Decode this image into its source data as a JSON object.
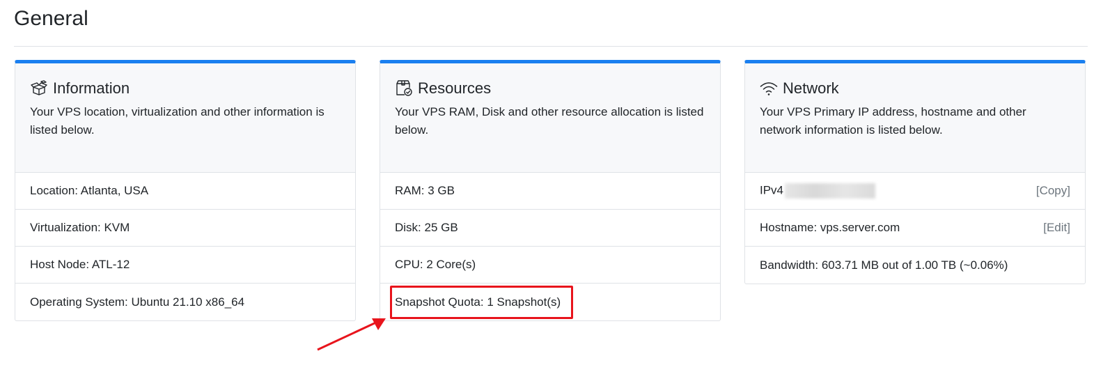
{
  "page": {
    "title": "General"
  },
  "cards": {
    "information": {
      "icon": "boxes-icon",
      "title": "Information",
      "description": "Your VPS location, virtualization and other information is listed below.",
      "rows": [
        "Location: Atlanta, USA",
        "Virtualization: KVM",
        "Host Node: ATL-12",
        "Operating System: Ubuntu 21.10 x86_64"
      ]
    },
    "resources": {
      "icon": "box-check-icon",
      "title": "Resources",
      "description": "Your VPS RAM, Disk and other resource allocation is listed below.",
      "rows": [
        "RAM: 3 GB",
        "Disk: 25 GB",
        "CPU: 2 Core(s)",
        "Snapshot Quota: 1 Snapshot(s)"
      ]
    },
    "network": {
      "icon": "wifi-icon",
      "title": "Network",
      "description": "Your VPS Primary IP address, hostname and other network information is listed below.",
      "rows": {
        "ipv4_label": "IPv4",
        "ipv4_action": "Copy",
        "hostname": "Hostname: vps.server.com",
        "hostname_action": "Edit",
        "bandwidth": "Bandwidth: 603.71 MB out of 1.00 TB (~0.06%)"
      }
    }
  },
  "annotation": {
    "highlight_color": "#e8141c"
  },
  "colors": {
    "accent": "#1a7ff0"
  }
}
